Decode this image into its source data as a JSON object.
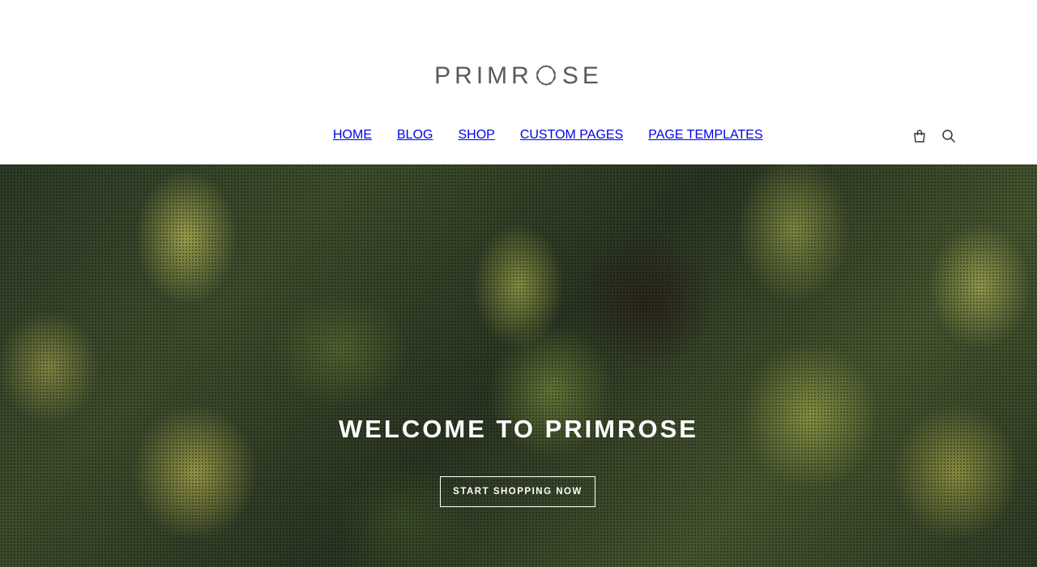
{
  "header": {
    "logo_text": "PRIMROSE",
    "logo_left": "PRIMR",
    "logo_right": "SE"
  },
  "nav": {
    "items": [
      {
        "label": "HOME"
      },
      {
        "label": "BLOG"
      },
      {
        "label": "SHOP"
      },
      {
        "label": "CUSTOM PAGES"
      },
      {
        "label": "PAGE TEMPLATES"
      }
    ]
  },
  "icons": {
    "cart": "shopping-bag-icon",
    "search": "search-icon"
  },
  "hero": {
    "title": "WELCOME TO PRIMROSE",
    "button_label": "START SHOPPING NOW"
  },
  "colors": {
    "header_bg": "#ffffff",
    "logo": "#5a5a5a",
    "nav_text": "#333333",
    "hero_text": "#ffffff"
  }
}
